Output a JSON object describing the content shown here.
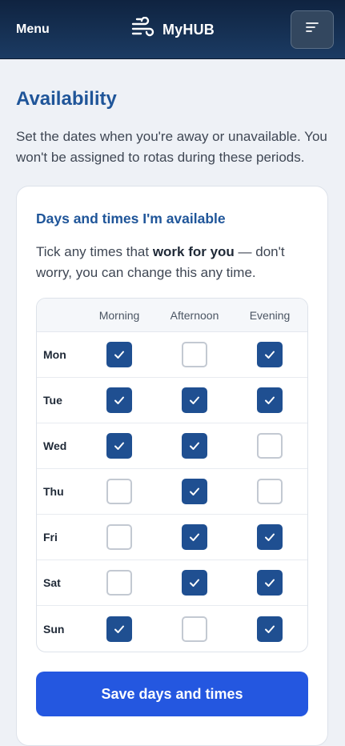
{
  "header": {
    "menu_label": "Menu",
    "brand_name": "MyHUB",
    "brand_icon": "wind-icon",
    "filter_icon": "sort-icon"
  },
  "page": {
    "title": "Availability",
    "intro": "Set the dates when you're away or unavailable. You won't be assigned to rotas during these periods."
  },
  "availability": {
    "title": "Days and times I'm available",
    "help_before": "Tick any times that ",
    "help_bold": "work for you",
    "help_after": " — don't worry, you can change this any time.",
    "columns": [
      "Morning",
      "Afternoon",
      "Evening"
    ],
    "rows": [
      {
        "day": "Mon",
        "slots": [
          true,
          false,
          true
        ]
      },
      {
        "day": "Tue",
        "slots": [
          true,
          true,
          true
        ]
      },
      {
        "day": "Wed",
        "slots": [
          true,
          true,
          false
        ]
      },
      {
        "day": "Thu",
        "slots": [
          false,
          true,
          false
        ]
      },
      {
        "day": "Fri",
        "slots": [
          false,
          true,
          true
        ]
      },
      {
        "day": "Sat",
        "slots": [
          false,
          true,
          true
        ]
      },
      {
        "day": "Sun",
        "slots": [
          true,
          false,
          true
        ]
      }
    ],
    "save_label": "Save days and times"
  },
  "colors": {
    "header_bg": "#0f2340",
    "title_blue": "#1f5599",
    "checked": "#1f4f91",
    "primary_button": "#2457e0"
  }
}
